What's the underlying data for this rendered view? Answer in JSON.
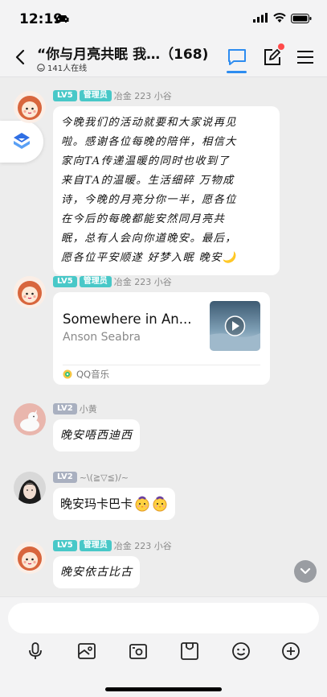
{
  "status_bar": {
    "time": "12:19"
  },
  "header": {
    "title": "“你与月亮共眠 我…（168)",
    "online": "141人在线"
  },
  "messages": [
    {
      "level": "LV5",
      "role": "管理员",
      "sender": "冶金 223 小谷",
      "lines": [
        "今晚我们的活动就要和大家说再见",
        "啦。感谢各位每晚的陪伴，相信大",
        "家向TA传递温暖的同时也收到了",
        "来自TA的温暖。生活细碎 万物成",
        "诗，今晚的月亮分你一半，愿各位",
        "在今后的每晚都能安然同月亮共",
        "眠，总有人会向你道晚安。最后，",
        "愿各位平安顺遂 好梦入眠 晚安🌙"
      ]
    },
    {
      "level": "LV5",
      "role": "管理员",
      "sender": "冶金 223 小谷",
      "music": {
        "title": "Somewhere in An...",
        "artist": "Anson Seabra",
        "source": "QQ音乐"
      }
    },
    {
      "level": "LV2",
      "sender": "小黄",
      "text": "晚安唔西迪西"
    },
    {
      "level": "LV2",
      "sender": "~\\(≧▽≦)/~",
      "text": "晚安玛卡巴卡"
    },
    {
      "level": "LV5",
      "role": "管理员",
      "sender": "冶金 223 小谷",
      "text": "晚安依古比古"
    }
  ],
  "colors": {
    "accent": "#2d8cf0",
    "level_badge": "#48c8c8",
    "level_badge_low": "#a9b0c0",
    "notification": "#ff4a4a"
  },
  "icons": [
    "car-icon",
    "signal-icon",
    "wifi-icon",
    "battery-icon",
    "back-icon",
    "chat-tab-icon",
    "edit-icon",
    "menu-icon",
    "microphone-icon",
    "image-icon",
    "camera-icon",
    "sticker-icon",
    "emoji-icon",
    "plus-icon"
  ]
}
